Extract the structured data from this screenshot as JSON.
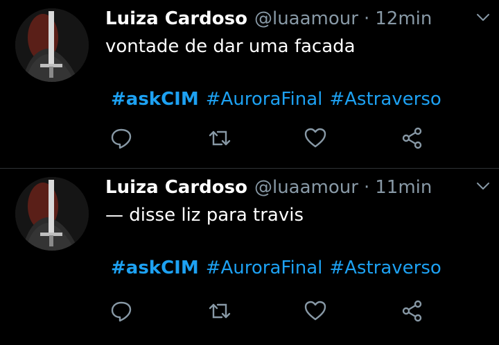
{
  "tweets": [
    {
      "name": "Luiza Cardoso",
      "handle": "@luaamour",
      "separator": "·",
      "time": "12min",
      "text": "vontade de dar uma facada",
      "hashtags": [
        "#askCIM",
        "#AuroraFinal",
        "#Astraverso"
      ]
    },
    {
      "name": "Luiza Cardoso",
      "handle": "@luaamour",
      "separator": "·",
      "time": "11min",
      "text": "— disse liz para travis",
      "hashtags": [
        "#askCIM",
        "#AuroraFinal",
        "#Astraverso"
      ]
    }
  ],
  "icons": {
    "reply": "reply-icon",
    "retweet": "retweet-icon",
    "like": "heart-icon",
    "share": "share-icon",
    "more": "chevron-down-icon"
  },
  "colors": {
    "background": "#000000",
    "text": "#ffffff",
    "muted": "#8899a6",
    "hashtag": "#1da1f2",
    "divider": "#2f3336"
  }
}
